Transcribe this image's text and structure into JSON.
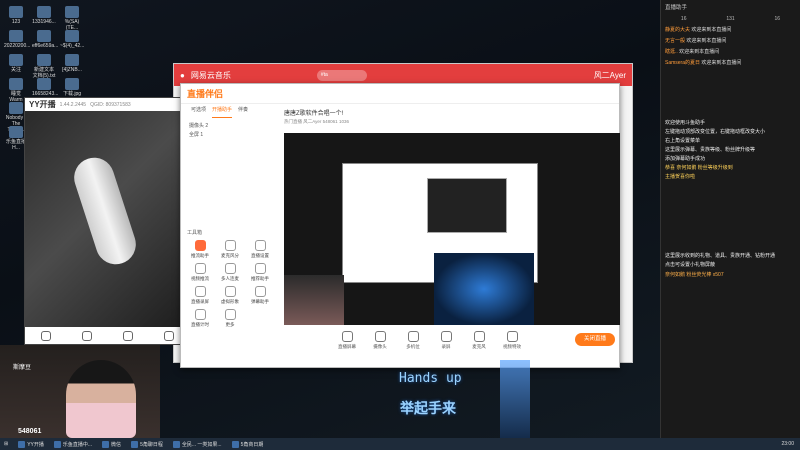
{
  "desktop_icons": [
    "123",
    "20220200...",
    "关注",
    "睡觉 Warm Snow",
    "Nobody - The Turna...",
    "乐鱼直播H...",
    "1331946...",
    "eff6e659a...",
    "新建文本文档(5).txt",
    "16658243...",
    "消费图片 2023061...",
    "我的电脑",
    "%(SA)(TE...",
    "~$(4)_42...",
    "[4]ZNB...",
    "下载.jpg",
    "翡翠抽奖",
    "鲸歌"
  ],
  "yy_window": {
    "title": "YY开播",
    "version": "1.44.2.2445",
    "qid": "QGID: 809371583"
  },
  "music": {
    "app_title": "网易云音乐",
    "search": "#ta",
    "user": "风二Ayer"
  },
  "assistant": {
    "logo": "直播伴侣",
    "tabs": [
      "可选项",
      "开播助手",
      "伴奏"
    ],
    "scene_items": [
      "摄像头 2",
      "全屏 1"
    ],
    "tools_label": "工具箱",
    "tools": [
      "推流助手",
      "麦克风分",
      "直播设置",
      "视频推流",
      "多人连麦",
      "推荐助手",
      "直播录屏",
      "虚拟形象",
      "弹幕助手",
      "直播计时",
      "更多"
    ],
    "stream_title": "唐唐Z歌软件合唱一个!",
    "stream_sub": "热门直播  风二Ayer  548061  1036",
    "controls": [
      "直播屏幕",
      "摄像头",
      "多机位",
      "录屏",
      "麦克风",
      "视频特效"
    ],
    "go_live": "关闭直播"
  },
  "streamer": {
    "name": "斯摩豆",
    "viewers": "548061"
  },
  "overlay": {
    "lyric_en": "Hands up",
    "lyric_cn": "举起手来"
  },
  "chat": {
    "header": "直播助手",
    "stats": [
      "16",
      "131",
      "16"
    ],
    "messages": [
      {
        "user": "静夏的大夫",
        "text": "欢迎来到本直播间"
      },
      {
        "user": "无言一般",
        "text": "欢迎来到本直播间"
      },
      {
        "user": "瞎逛..",
        "text": "欢迎来到本直播间"
      },
      {
        "user": "Samsera的夏日",
        "text": "欢迎来到本直播间"
      }
    ],
    "system_lines": [
      "欢迎使用斗鱼助手",
      "左键拖动顶部改变位置，右键拖动框改变大小",
      "右上角设置菜单",
      "这里展示弹幕、贵族等级、粉丝牌升级等",
      "添加弹幕助手成功"
    ],
    "highlight": "恭喜 奈何如鹅 粉丝等级升级到",
    "highlight2": "主播贺喜你啦",
    "gift_lines": [
      "这里展示收到的礼物、道具、贵族开通、钻粉开通",
      "点击可设置小礼物屏蔽"
    ],
    "gift": "奈何如鹅 粉丝荧光棒 x507"
  },
  "taskbar": {
    "items": [
      "YY开播",
      "乐鱼直播中...",
      "微信",
      "5角聊日程",
      "全民... 一类如果...",
      "5角商日期"
    ],
    "time": "23:00"
  }
}
